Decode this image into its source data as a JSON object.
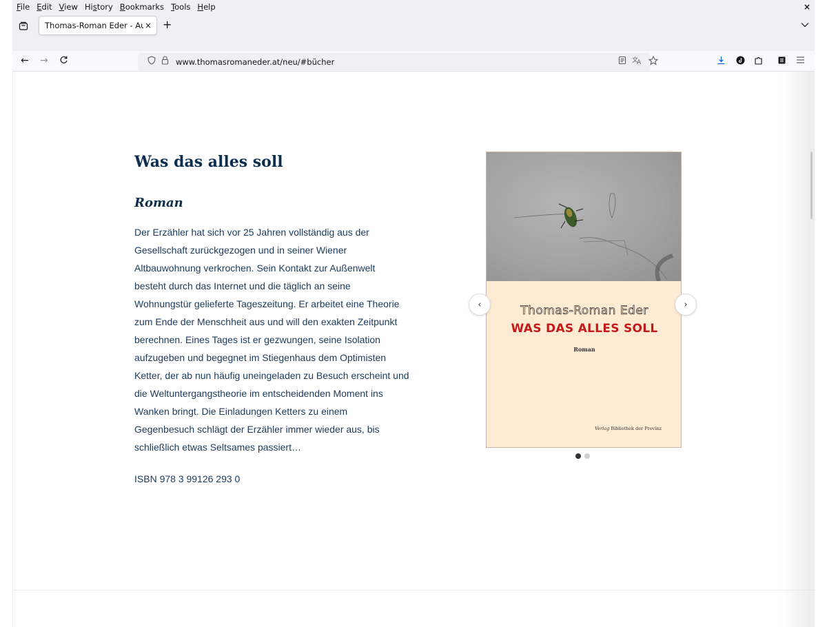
{
  "menubar": {
    "items": [
      {
        "underline": "F",
        "rest": "ile"
      },
      {
        "underline": "E",
        "rest": "dit"
      },
      {
        "underline": "V",
        "rest": "iew"
      },
      {
        "pre": "Hi",
        "underline": "s",
        "rest": "tory"
      },
      {
        "underline": "B",
        "rest": "ookmarks"
      },
      {
        "underline": "T",
        "rest": "ools"
      },
      {
        "underline": "H",
        "rest": "elp"
      }
    ],
    "close_glyph": "×"
  },
  "tabs": [
    {
      "title": "Thomas-Roman Eder - Autor",
      "close_glyph": "×"
    }
  ],
  "newtab_glyph": "+",
  "tab_list_glyph": "∨",
  "nav": {
    "back_glyph": "←",
    "forward_glyph": "→",
    "reload_glyph": "↻",
    "url": "www.thomasromaneder.at/neu/#bücher"
  },
  "icons": {
    "tab_overview": "tab-overview-icon",
    "shield": "tracking-shield-icon",
    "lock": "lock-icon",
    "reader": "reader-view-icon",
    "translate": "translate-icon",
    "bookmark": "bookmark-star-icon",
    "download": "download-icon",
    "account": "account-icon",
    "extensions": "extensions-icon",
    "sidebar": "sidebar-icon",
    "menu": "hamburger-menu-icon"
  },
  "book": {
    "title": "Was das alles soll",
    "subtitle": "Roman",
    "description_lines": [
      "Der Erzähler hat sich vor 25 Jahren vollständig aus der",
      "Gesellschaft zurückgezogen und in seiner Wiener",
      "Altbauwohnung verkrochen. Sein Kontakt zur Außenwelt",
      "besteht durch das Internet und die täglich an seine",
      "Wohnungstür gelieferte Tageszeitung. Er arbeitet eine Theorie",
      "zum Ende der Menschheit aus und will den exakten Zeitpunkt",
      "berechnen. Eines Tages ist er gezwungen, seine Isolation",
      "aufzugeben und begegnet im Stiegenhaus dem Optimisten",
      "Ketter, der ab nun häufig uneingeladen zu Besuch erscheint und",
      "die Weltuntergangstheorie im entscheidenden Moment ins",
      "Wanken bringt. Die Einladungen Ketters zu einem",
      "Gegenbesuch schlägt der Erzähler immer wieder aus, bis",
      "schließlich etwas Seltsames passiert…"
    ],
    "isbn": "ISBN 978 3 99126 293 0"
  },
  "cover": {
    "author": "Thomas-Roman Eder",
    "title": "WAS DAS ALLES SOLL",
    "subtitle": "Roman",
    "publisher_italic": "Verlag",
    "publisher": "Bibliothek der Provinz",
    "colors": {
      "background": "#fdebd3",
      "title": "#c41a1a"
    }
  },
  "carousel": {
    "prev_glyph": "‹",
    "next_glyph": "›",
    "slide_count": 2,
    "active_index": 0
  }
}
